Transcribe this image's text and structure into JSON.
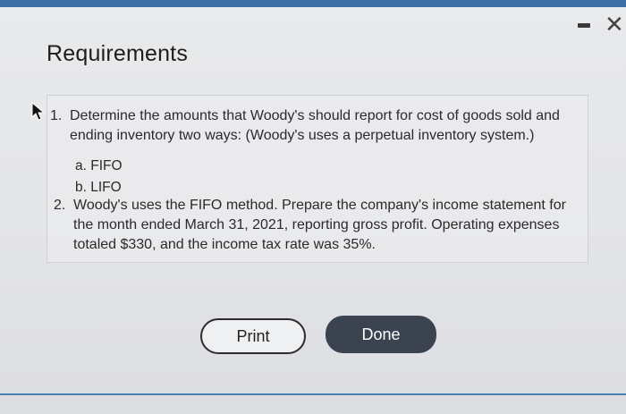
{
  "window": {
    "minimize_icon": "minimize-icon",
    "close_icon": "close-icon",
    "close_glyph": "✕"
  },
  "title": "Requirements",
  "requirements": [
    {
      "number": "1.",
      "lines": [
        "Determine the amounts that Woody's should report for cost of goods sold and",
        "ending inventory two ways: (Woody's uses a perpetual inventory system.)"
      ],
      "subitems": [
        "a. FIFO",
        "b. LIFO"
      ]
    },
    {
      "number": "2.",
      "lines": [
        "Woody's uses the FIFO method. Prepare the company's income statement for",
        "the month ended March 31, 2021, reporting gross profit. Operating expenses",
        "totaled $330, and the income tax rate was 35%."
      ]
    }
  ],
  "buttons": {
    "print": "Print",
    "done": "Done"
  },
  "colors": {
    "accent_bar": "#3c6fa4",
    "done_bg": "#3b4350",
    "done_text": "#ffffff"
  }
}
